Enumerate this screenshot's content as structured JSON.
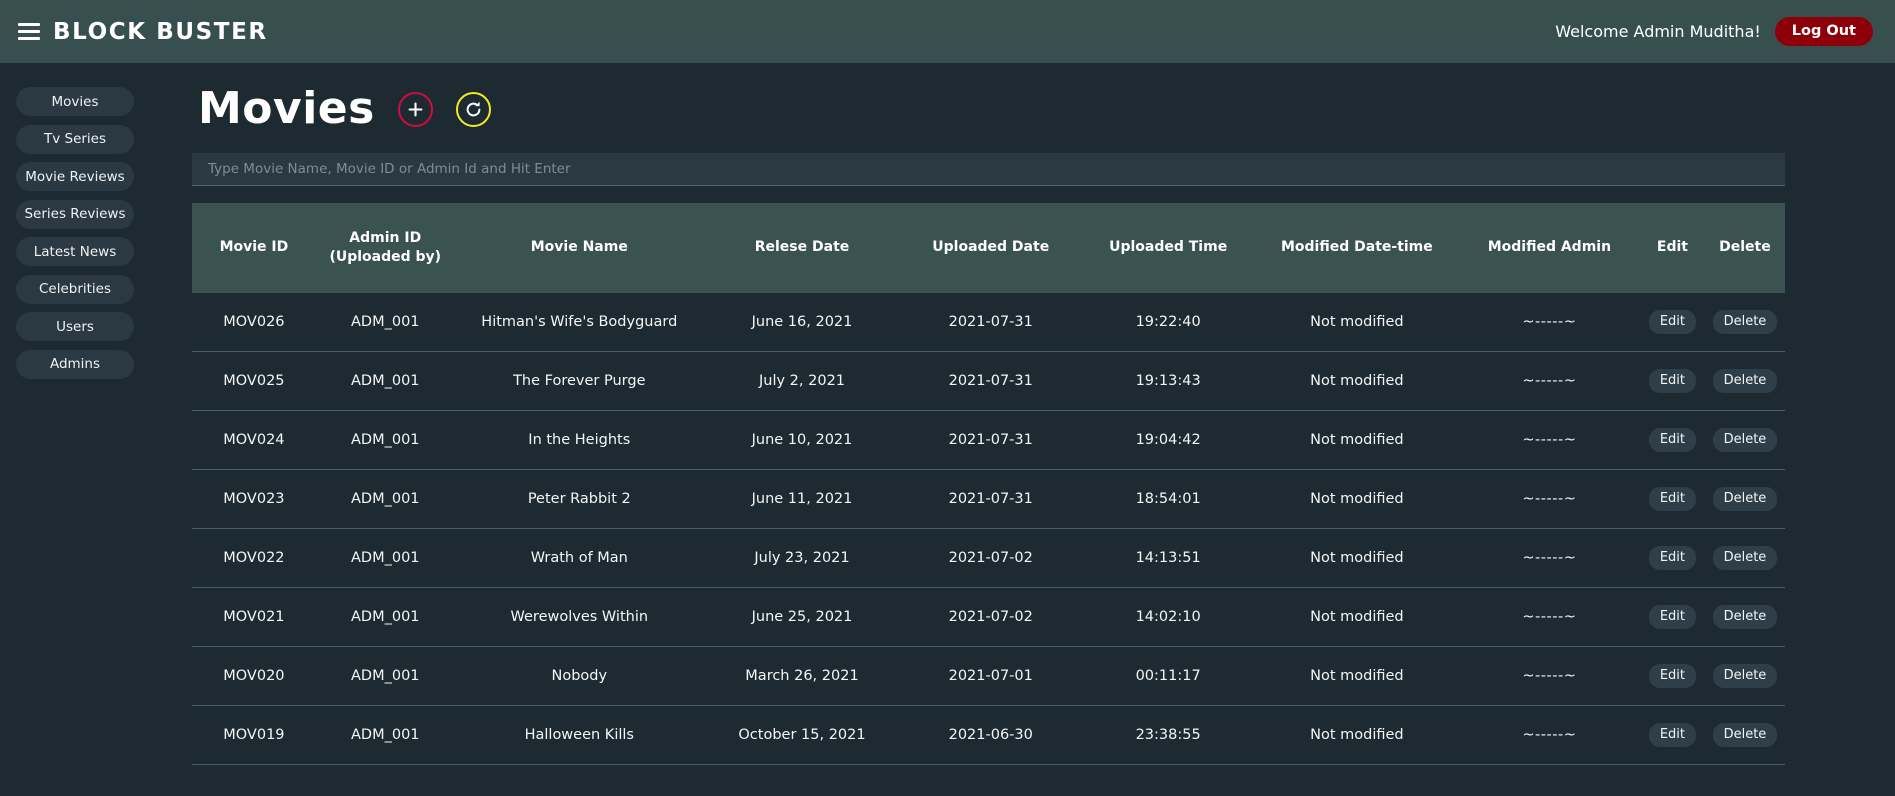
{
  "topbar": {
    "menu_icon": "hamburger-icon",
    "brand": "BLOCK BUSTER",
    "welcome": "Welcome Admin Muditha!",
    "logout_label": "Log Out",
    "logout_color": "#8d0009",
    "bar_color": "#37504f"
  },
  "sidebar": {
    "items": [
      {
        "label": "Movies"
      },
      {
        "label": "Tv Series"
      },
      {
        "label": "Movie Reviews"
      },
      {
        "label": "Series Reviews"
      },
      {
        "label": "Latest News"
      },
      {
        "label": "Celebrities"
      },
      {
        "label": "Users"
      },
      {
        "label": "Admins"
      }
    ]
  },
  "main": {
    "page_title": "Movies",
    "add_button": {
      "icon": "plus-icon",
      "color": "#d60a3f"
    },
    "refresh_button": {
      "icon": "refresh-icon",
      "color": "#f2ed1f"
    }
  },
  "search": {
    "placeholder": "Type Movie Name, Movie ID or Admin Id and Hit Enter",
    "value": ""
  },
  "table": {
    "headers": {
      "movie_id": "Movie ID",
      "admin_id_line1": "Admin ID",
      "admin_id_line2": "(Uploaded by)",
      "movie_name": "Movie Name",
      "release_date": "Relese Date",
      "uploaded_date": "Uploaded Date",
      "uploaded_time": "Uploaded Time",
      "modified_datetime": "Modified Date-time",
      "modified_admin": "Modified Admin",
      "edit": "Edit",
      "delete": "Delete"
    },
    "row_actions": {
      "edit_label": "Edit",
      "delete_label": "Delete"
    },
    "rows": [
      {
        "movie_id": "MOV026",
        "admin_id": "ADM_001",
        "movie_name": "Hitman's Wife's Bodyguard",
        "release_date": "June 16, 2021",
        "uploaded_date": "2021-07-31",
        "uploaded_time": "19:22:40",
        "modified_datetime": "Not modified",
        "modified_admin": "~-----~"
      },
      {
        "movie_id": "MOV025",
        "admin_id": "ADM_001",
        "movie_name": "The Forever Purge",
        "release_date": "July 2, 2021",
        "uploaded_date": "2021-07-31",
        "uploaded_time": "19:13:43",
        "modified_datetime": "Not modified",
        "modified_admin": "~-----~"
      },
      {
        "movie_id": "MOV024",
        "admin_id": "ADM_001",
        "movie_name": "In the Heights",
        "release_date": "June 10, 2021",
        "uploaded_date": "2021-07-31",
        "uploaded_time": "19:04:42",
        "modified_datetime": "Not modified",
        "modified_admin": "~-----~"
      },
      {
        "movie_id": "MOV023",
        "admin_id": "ADM_001",
        "movie_name": "Peter Rabbit 2",
        "release_date": "June 11, 2021",
        "uploaded_date": "2021-07-31",
        "uploaded_time": "18:54:01",
        "modified_datetime": "Not modified",
        "modified_admin": "~-----~"
      },
      {
        "movie_id": "MOV022",
        "admin_id": "ADM_001",
        "movie_name": "Wrath of Man",
        "release_date": "July 23, 2021",
        "uploaded_date": "2021-07-02",
        "uploaded_time": "14:13:51",
        "modified_datetime": "Not modified",
        "modified_admin": "~-----~"
      },
      {
        "movie_id": "MOV021",
        "admin_id": "ADM_001",
        "movie_name": "Werewolves Within",
        "release_date": "June 25, 2021",
        "uploaded_date": "2021-07-02",
        "uploaded_time": "14:02:10",
        "modified_datetime": "Not modified",
        "modified_admin": "~-----~"
      },
      {
        "movie_id": "MOV020",
        "admin_id": "ADM_001",
        "movie_name": "Nobody",
        "release_date": "March 26, 2021",
        "uploaded_date": "2021-07-01",
        "uploaded_time": "00:11:17",
        "modified_datetime": "Not modified",
        "modified_admin": "~-----~"
      },
      {
        "movie_id": "MOV019",
        "admin_id": "ADM_001",
        "movie_name": "Halloween Kills",
        "release_date": "October 15, 2021",
        "uploaded_date": "2021-06-30",
        "uploaded_time": "23:38:55",
        "modified_datetime": "Not modified",
        "modified_admin": "~-----~"
      }
    ]
  }
}
